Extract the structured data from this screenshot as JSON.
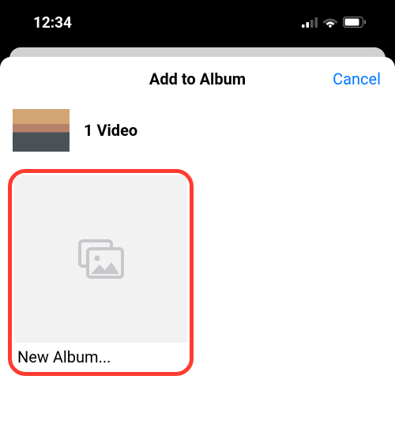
{
  "status_bar": {
    "time": "12:34"
  },
  "sheet": {
    "title": "Add to Album",
    "cancel_label": "Cancel"
  },
  "selection": {
    "count_label": "1 Video"
  },
  "new_album": {
    "label": "New Album..."
  }
}
